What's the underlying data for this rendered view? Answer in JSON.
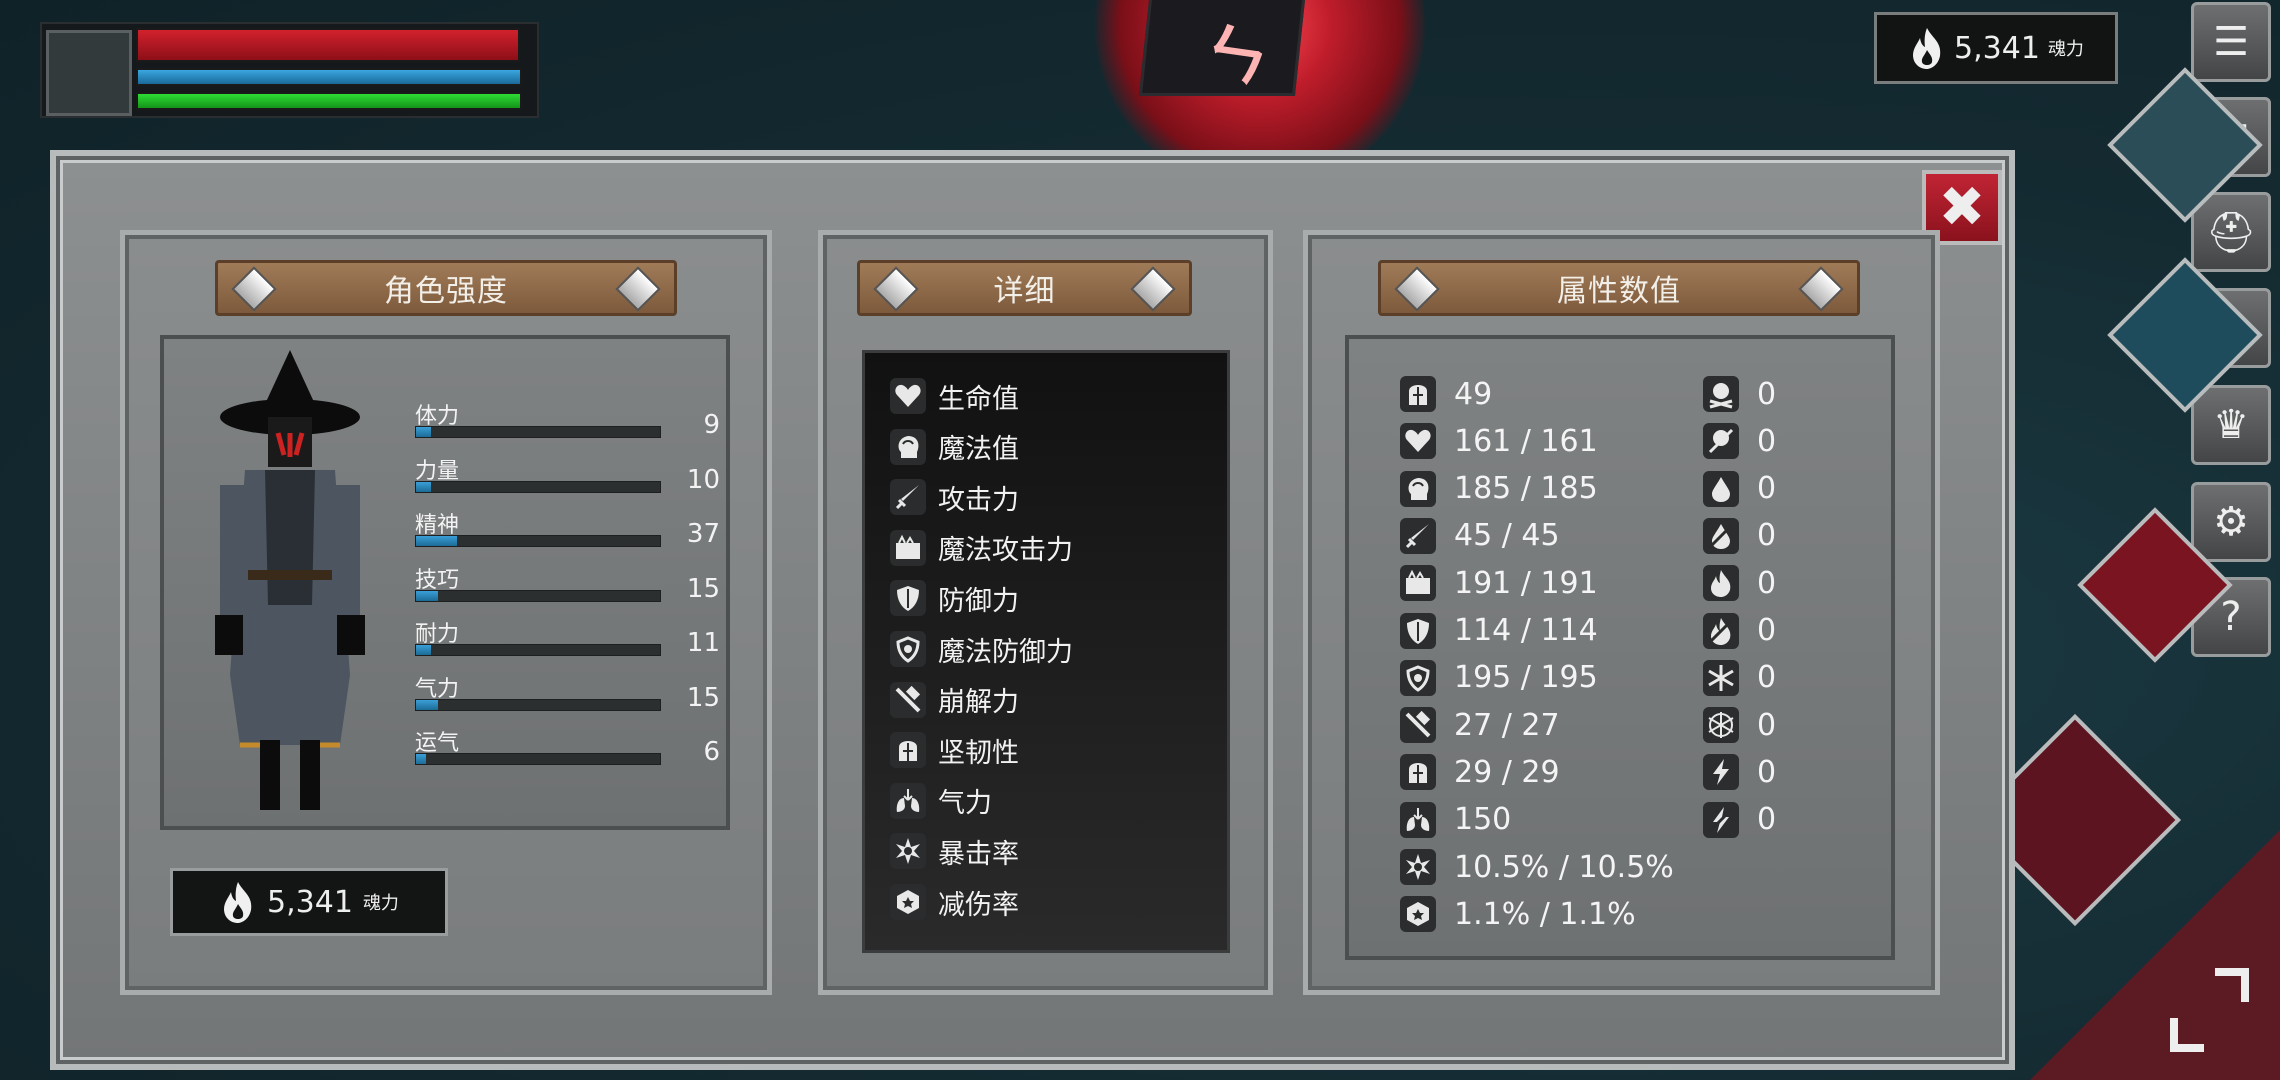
{
  "hud": {
    "hp_fill": 1.0,
    "mp_fill": 1.0,
    "stamina_fill": 1.0
  },
  "currency": {
    "value": "5,341",
    "unit": "魂力"
  },
  "colors": {
    "hp": "#c41c28",
    "mp": "#2b8fc4",
    "stamina": "#22c32b",
    "banner": "#8d6a4b",
    "close": "#a61b29",
    "stat_bar": "#2a86bd"
  },
  "side_menu": [
    {
      "name": "menu-icon",
      "glyph": "☰"
    },
    {
      "name": "scroll-icon",
      "glyph": "▣"
    },
    {
      "name": "helmet-icon",
      "glyph": "⛑"
    },
    {
      "name": "medallion-icon",
      "glyph": "◎"
    },
    {
      "name": "crown-icon",
      "glyph": "♛"
    },
    {
      "name": "gear-icon",
      "glyph": "⚙"
    },
    {
      "name": "help-icon",
      "glyph": "?"
    }
  ],
  "panels": {
    "character": {
      "title": "角色强度",
      "stats": [
        {
          "label": "体力",
          "value": "9",
          "fill": 0.06
        },
        {
          "label": "力量",
          "value": "10",
          "fill": 0.06
        },
        {
          "label": "精神",
          "value": "37",
          "fill": 0.17
        },
        {
          "label": "技巧",
          "value": "15",
          "fill": 0.09
        },
        {
          "label": "耐力",
          "value": "11",
          "fill": 0.06
        },
        {
          "label": "气力",
          "value": "15",
          "fill": 0.09
        },
        {
          "label": "运气",
          "value": "6",
          "fill": 0.04
        }
      ]
    },
    "details": {
      "title": "详细",
      "items": [
        {
          "label": "生命值",
          "icon": "heart-icon"
        },
        {
          "label": "魔法值",
          "icon": "head-icon"
        },
        {
          "label": "攻击力",
          "icon": "sword-icon"
        },
        {
          "label": "魔法攻击力",
          "icon": "spellbook-icon"
        },
        {
          "label": "防御力",
          "icon": "shield-icon"
        },
        {
          "label": "魔法防御力",
          "icon": "magic-shield-icon"
        },
        {
          "label": "崩解力",
          "icon": "hammer-icon"
        },
        {
          "label": "坚韧性",
          "icon": "helmet-icon"
        },
        {
          "label": "气力",
          "icon": "lungs-icon"
        },
        {
          "label": "暴击率",
          "icon": "star-icon"
        },
        {
          "label": "减伤率",
          "icon": "badge-icon"
        }
      ]
    },
    "attributes": {
      "title": "属性数值",
      "left": [
        {
          "value": "49",
          "icon": "helmet-icon"
        },
        {
          "value": "161 / 161",
          "icon": "heart-icon"
        },
        {
          "value": "185 / 185",
          "icon": "head-icon"
        },
        {
          "value": "45 / 45",
          "icon": "sword-icon"
        },
        {
          "value": "191 / 191",
          "icon": "spellbook-icon"
        },
        {
          "value": "114 / 114",
          "icon": "shield-icon"
        },
        {
          "value": "195 / 195",
          "icon": "magic-shield-icon"
        },
        {
          "value": "27 / 27",
          "icon": "hammer-icon"
        },
        {
          "value": "29 / 29",
          "icon": "helmet-icon"
        },
        {
          "value": "150",
          "icon": "lungs-icon"
        },
        {
          "value": "10.5% / 10.5%",
          "icon": "star-icon"
        },
        {
          "value": "1.1% / 1.1%",
          "icon": "badge-icon"
        }
      ],
      "right": [
        {
          "value": "0",
          "icon": "skull-icon"
        },
        {
          "value": "0",
          "icon": "skull-slash-icon"
        },
        {
          "value": "0",
          "icon": "drop-icon"
        },
        {
          "value": "0",
          "icon": "drop-slash-icon"
        },
        {
          "value": "0",
          "icon": "fire-icon"
        },
        {
          "value": "0",
          "icon": "fire-slash-icon"
        },
        {
          "value": "0",
          "icon": "snowflake-icon"
        },
        {
          "value": "0",
          "icon": "snowflake-slash-icon"
        },
        {
          "value": "0",
          "icon": "lightning-icon"
        },
        {
          "value": "0",
          "icon": "lightning-slash-icon"
        }
      ]
    }
  }
}
